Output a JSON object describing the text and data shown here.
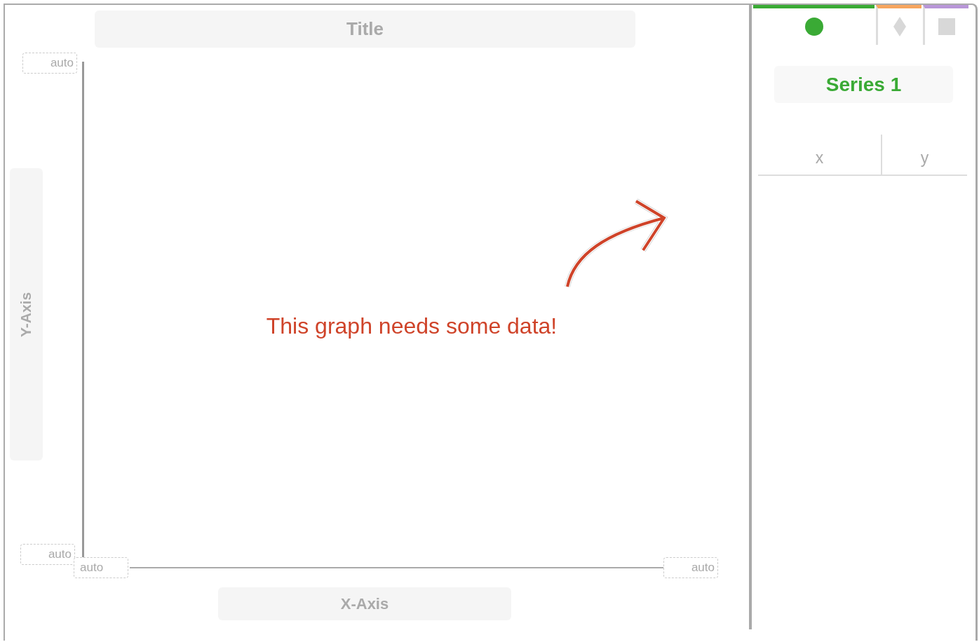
{
  "chart": {
    "title": "Title",
    "message": "This graph needs some data!",
    "y_axis": {
      "label": "Y-Axis",
      "max": "auto",
      "min": "auto"
    },
    "x_axis": {
      "label": "X-Axis",
      "min": "auto",
      "max": "auto"
    }
  },
  "series_tabs": [
    {
      "kind": "circle",
      "color": "#3aaa35",
      "selected": true
    },
    {
      "kind": "diamond",
      "color": "#f7a55e",
      "selected": false
    },
    {
      "kind": "square",
      "color": "#b896d8",
      "selected": false
    }
  ],
  "series_name": "Series 1",
  "table": {
    "columns": [
      "x",
      "y"
    ]
  }
}
